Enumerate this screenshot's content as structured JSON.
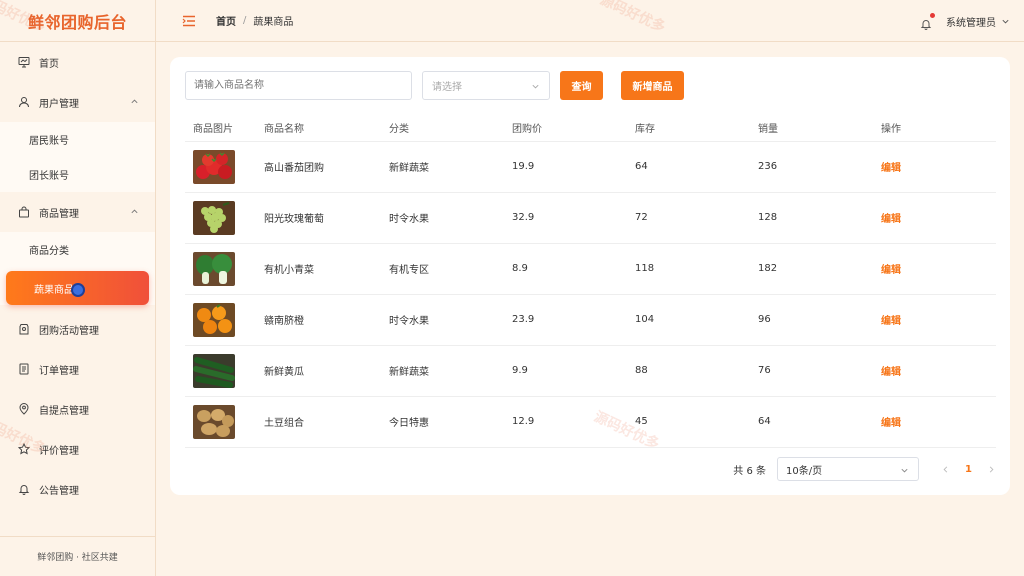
{
  "app": {
    "title": "鲜邻团购后台",
    "footer": "鲜邻团购 · 社区共建"
  },
  "sidebar": {
    "items": [
      {
        "label": "首页",
        "icon": "dashboard-icon"
      },
      {
        "label": "用户管理",
        "icon": "user-icon",
        "expanded": true,
        "children": [
          {
            "label": "居民账号"
          },
          {
            "label": "团长账号"
          }
        ]
      },
      {
        "label": "商品管理",
        "icon": "bag-icon",
        "expanded": true,
        "children": [
          {
            "label": "商品分类"
          },
          {
            "label": "蔬果商品",
            "active": true
          }
        ]
      },
      {
        "label": "团购活动管理",
        "icon": "activity-icon"
      },
      {
        "label": "订单管理",
        "icon": "order-icon"
      },
      {
        "label": "自提点管理",
        "icon": "location-icon"
      },
      {
        "label": "评价管理",
        "icon": "star-icon"
      },
      {
        "label": "公告管理",
        "icon": "bell-icon"
      }
    ]
  },
  "header": {
    "breadcrumb": {
      "home": "首页",
      "separator": "/",
      "current": "蔬果商品"
    },
    "user": "系统管理员",
    "has_notification": true
  },
  "filters": {
    "name_placeholder": "请输入商品名称",
    "category_placeholder": "请选择",
    "query_label": "查询",
    "add_label": "新增商品"
  },
  "table": {
    "columns": [
      "商品图片",
      "商品名称",
      "分类",
      "团购价",
      "库存",
      "销量",
      "操作"
    ],
    "rows": [
      {
        "image": "tomato",
        "name": "高山番茄团购",
        "category": "新鲜蔬菜",
        "price": "19.9",
        "stock": "64",
        "sales": "236",
        "action": "编辑"
      },
      {
        "image": "grape",
        "name": "阳光玫瑰葡萄",
        "category": "时令水果",
        "price": "32.9",
        "stock": "72",
        "sales": "128",
        "action": "编辑"
      },
      {
        "image": "bokchoy",
        "name": "有机小青菜",
        "category": "有机专区",
        "price": "8.9",
        "stock": "118",
        "sales": "182",
        "action": "编辑"
      },
      {
        "image": "orange",
        "name": "赣南脐橙",
        "category": "时令水果",
        "price": "23.9",
        "stock": "104",
        "sales": "96",
        "action": "编辑"
      },
      {
        "image": "cucumber",
        "name": "新鲜黄瓜",
        "category": "新鲜蔬菜",
        "price": "9.9",
        "stock": "88",
        "sales": "76",
        "action": "编辑"
      },
      {
        "image": "potato",
        "name": "土豆组合",
        "category": "今日特惠",
        "price": "12.9",
        "stock": "45",
        "sales": "64",
        "action": "编辑"
      }
    ]
  },
  "pagination": {
    "total": "共 6 条",
    "page_size": "10条/页",
    "current_page": "1"
  },
  "watermark": {
    "text": "源码好优多"
  },
  "colors": {
    "accent": "#f77619",
    "brand_title": "#e8642c",
    "active_start": "#ff7a1a",
    "active_end": "#f0503a",
    "page_bg": "#fdf3e8"
  }
}
